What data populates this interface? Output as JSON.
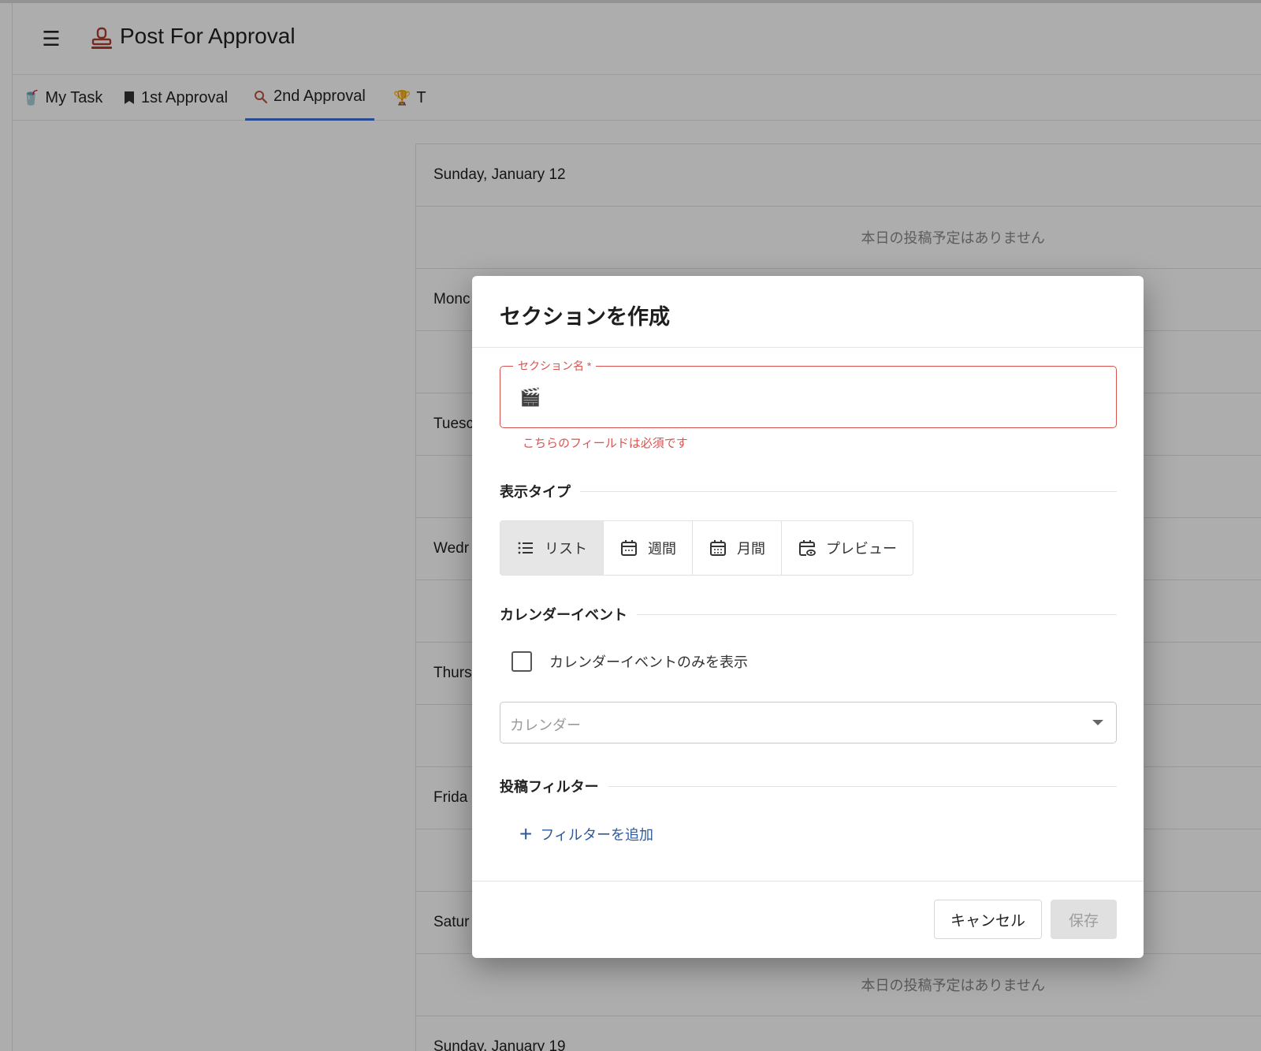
{
  "header": {
    "menu_icon": "hamburger-icon",
    "app_icon": "stamp-icon",
    "title": "Post For Approval"
  },
  "tabs": [
    {
      "label": "My Task",
      "icon": "🥤"
    },
    {
      "label": "1st Approval",
      "icon": "bookmark-icon"
    },
    {
      "label": "2nd Approval",
      "icon": "search-icon",
      "active": true
    },
    {
      "label": "T",
      "icon": "🏆"
    }
  ],
  "list": {
    "days": [
      {
        "label": "Sunday, January 12",
        "empty": "本日の投稿予定はありません"
      },
      {
        "label": "Monc",
        "empty": ""
      },
      {
        "label": "Tuesc",
        "empty": ""
      },
      {
        "label": "Wedr",
        "empty": ""
      },
      {
        "label": "Thurs",
        "empty": ""
      },
      {
        "label": "Frida",
        "empty": ""
      },
      {
        "label": "Satur",
        "empty": "本日の投稿予定はありません"
      },
      {
        "label": "Sunday, January 19",
        "empty": ""
      }
    ]
  },
  "dialog": {
    "title": "セクションを作成",
    "name_field": {
      "label": "セクション名 *",
      "value": "🎬",
      "error": "こちらのフィールドは必須です"
    },
    "display_type": {
      "label": "表示タイプ",
      "options": [
        {
          "label": "リスト",
          "icon": "list-icon",
          "active": true
        },
        {
          "label": "週間",
          "icon": "calendar-week-icon"
        },
        {
          "label": "月間",
          "icon": "calendar-month-icon"
        },
        {
          "label": "プレビュー",
          "icon": "calendar-preview-icon"
        }
      ]
    },
    "calendar_event": {
      "label": "カレンダーイベント",
      "checkbox_label": "カレンダーイベントのみを表示",
      "checked": false,
      "select_placeholder": "カレンダー"
    },
    "post_filter": {
      "label": "投稿フィルター",
      "add_label": "フィルターを追加"
    },
    "cancel_label": "キャンセル",
    "save_label": "保存"
  }
}
